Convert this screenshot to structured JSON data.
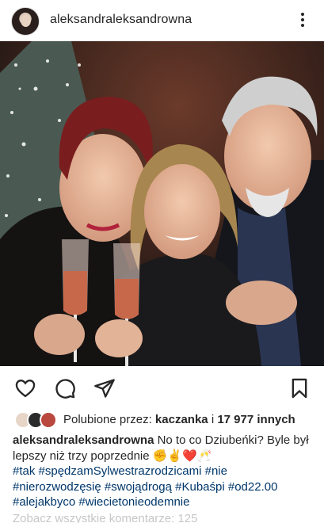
{
  "post": {
    "username": "aleksandraleksandrowna",
    "more_icon": "more-vertical-icon"
  },
  "actions": {
    "like_icon": "heart-icon",
    "comment_icon": "comment-icon",
    "share_icon": "send-icon",
    "save_icon": "bookmark-icon"
  },
  "likes": {
    "prefix": "Polubione przez:",
    "first_user": "kaczanka",
    "connector": "i",
    "count_label": "17 977 innych"
  },
  "caption": {
    "username": "aleksandraleksandrowna",
    "text": "No to co Dziubeńki? Byle był lepszy niż trzy poprzednie ✊✌️❤️🥂",
    "hashtags_line1": [
      "#tak",
      "#spędzamSylwestrazrodzicami",
      "#nie"
    ],
    "hashtags_line2": [
      "#nierozwodzęsię",
      "#swojądrogą",
      "#Kubaśpi",
      "#od22.00"
    ],
    "hashtags_line3": [
      "#alejakbyco",
      "#wiecietonieodemnie"
    ]
  },
  "comments_link": "Zobacz wszystkie komentarze: 125"
}
